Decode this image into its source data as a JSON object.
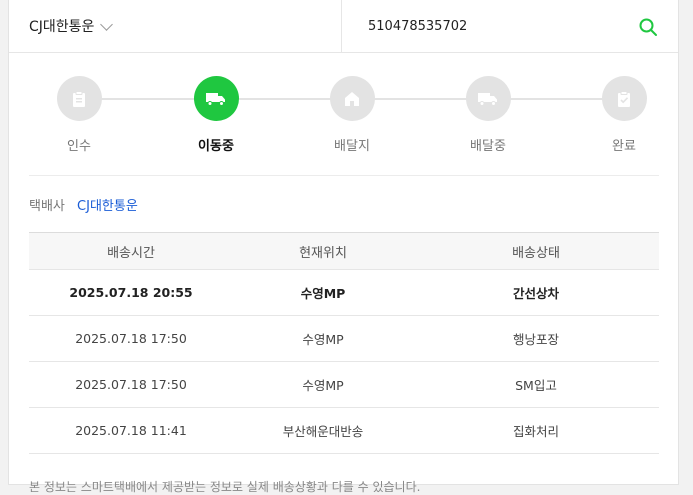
{
  "search": {
    "carrier": "CJ대한통운",
    "tracking_number": "510478535702"
  },
  "steps": [
    {
      "label": "인수",
      "icon": "clipboard-icon",
      "active": false
    },
    {
      "label": "이동중",
      "icon": "truck-icon",
      "active": true
    },
    {
      "label": "배달지",
      "icon": "house-icon",
      "active": false
    },
    {
      "label": "배달중",
      "icon": "delivery-truck-icon",
      "active": false
    },
    {
      "label": "완료",
      "icon": "check-clipboard-icon",
      "active": false
    }
  ],
  "courier": {
    "label": "택배사",
    "value": "CJ대한통운"
  },
  "table": {
    "headers": [
      "배송시간",
      "현재위치",
      "배송상태"
    ],
    "rows": [
      {
        "time": "2025.07.18 20:55",
        "location": "수영MP",
        "status": "간선상차"
      },
      {
        "time": "2025.07.18 17:50",
        "location": "수영MP",
        "status": "행낭포장"
      },
      {
        "time": "2025.07.18 17:50",
        "location": "수영MP",
        "status": "SM입고"
      },
      {
        "time": "2025.07.18 11:41",
        "location": "부산해운대반송",
        "status": "집화처리"
      }
    ]
  },
  "notice": "본 정보는 스마트택배에서 제공받는 정보로 실제 배송상황과 다를 수 있습니다.",
  "colors": {
    "accent": "#1fc740",
    "link": "#1a5cd6",
    "inactive": "#e3e3e3"
  }
}
